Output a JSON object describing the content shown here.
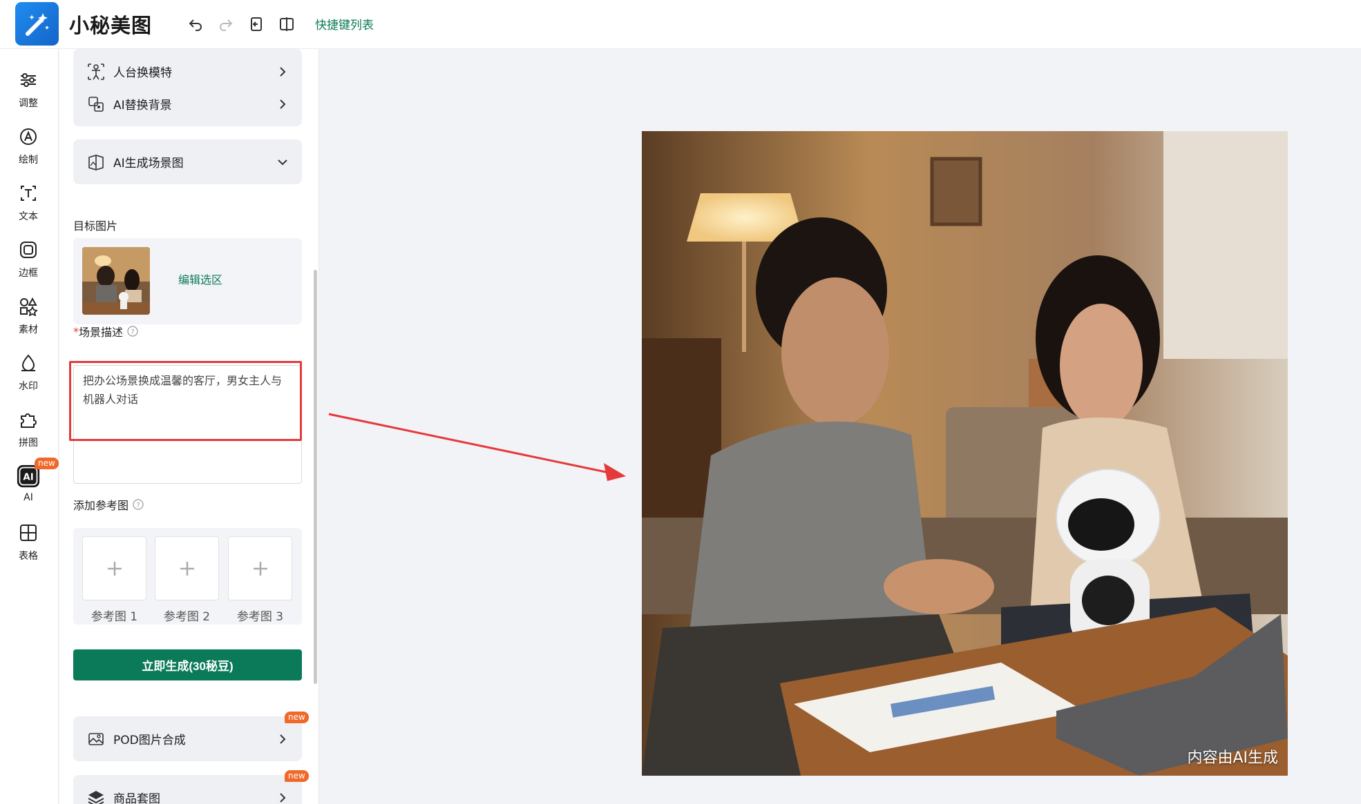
{
  "app": {
    "title": "小秘美图",
    "shortcut_link": "快捷键列表"
  },
  "rail": [
    {
      "label": "调整",
      "icon": "sliders-icon"
    },
    {
      "label": "绘制",
      "icon": "brush-icon"
    },
    {
      "label": "文本",
      "icon": "text-icon"
    },
    {
      "label": "边框",
      "icon": "frame-icon"
    },
    {
      "label": "素材",
      "icon": "shapes-icon"
    },
    {
      "label": "水印",
      "icon": "watermark-icon"
    },
    {
      "label": "拼图",
      "icon": "puzzle-icon"
    },
    {
      "label": "AI",
      "icon": "ai-icon",
      "badge": "new",
      "active": true
    },
    {
      "label": "表格",
      "icon": "table-icon"
    }
  ],
  "panel": {
    "cards": [
      {
        "label": "人台换模特"
      },
      {
        "label": "AI替换背景"
      },
      {
        "label": "AI生成场景图"
      }
    ],
    "target_label": "目标图片",
    "edit_selection": "编辑选区",
    "scene_label_required": "*",
    "scene_label": "场景描述",
    "scene_text": "把办公场景换成温馨的客厅，男女主人与机器人对话",
    "ref_label": "添加参考图",
    "ref_slots": [
      "参考图 1",
      "参考图 2",
      "参考图 3"
    ],
    "generate_button": "立即生成(30秘豆)",
    "more_cards": [
      {
        "label": "POD图片合成",
        "badge": "new"
      },
      {
        "label": "商品套图",
        "badge": "new"
      }
    ]
  },
  "canvas": {
    "watermark": "内容由AI生成"
  }
}
